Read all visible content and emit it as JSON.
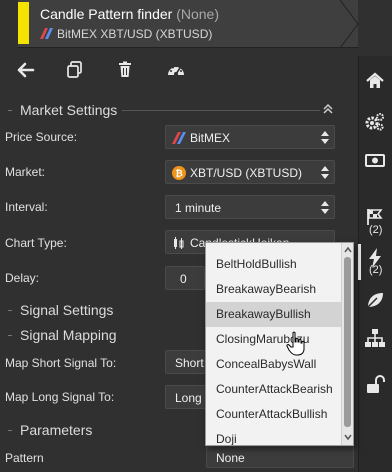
{
  "header": {
    "title": "Candle Pattern finder",
    "title_suffix": "(None)",
    "exchange_icon": "bitmex-logo-icon",
    "subtitle": "BitMEX XBT/USD (XBTUSD)",
    "accent_color": "#f4e200"
  },
  "toolbar": {
    "back_icon": "arrow-left-icon",
    "copy_icon": "copy-icon",
    "delete_icon": "trash-icon",
    "dashboard_icon": "gauge-icon"
  },
  "rail": {
    "items": [
      {
        "icon": "home-icon"
      },
      {
        "icon": "gears-icon"
      },
      {
        "icon": "money-icon"
      },
      {
        "icon": "bolt-icon",
        "count": "(2)"
      },
      {
        "icon": "flags-icon",
        "count": "(2)"
      },
      {
        "icon": "leaf-icon"
      },
      {
        "icon": "sitemap-icon"
      },
      {
        "icon": "unlock-icon"
      }
    ]
  },
  "market_settings": {
    "title": "Market Settings",
    "collapse_icon": "double-chevron-up-icon",
    "price_source": {
      "label": "Price Source:",
      "value": "BitMEX",
      "icon": "bitmex-logo-icon"
    },
    "market": {
      "label": "Market:",
      "value": "XBT/USD (XBTUSD)",
      "icon": "bitcoin-icon"
    },
    "interval": {
      "label": "Interval:",
      "value": "1 minute"
    },
    "chart_type": {
      "label": "Chart Type:",
      "value": "CandlestickHeikan",
      "icon": "candles-icon"
    },
    "delay": {
      "label": "Delay:",
      "value": "0"
    }
  },
  "signal_settings": {
    "title": "Signal Settings"
  },
  "signal_mapping": {
    "title": "Signal Mapping",
    "short": {
      "label": "Map Short Signal To:",
      "value": "Short"
    },
    "long": {
      "label": "Map Long Signal To:",
      "value": "Long"
    }
  },
  "parameters": {
    "title": "Parameters",
    "pattern": {
      "label": "Pattern",
      "value": "None"
    }
  },
  "pattern_dropdown": {
    "options": [
      "BeltHoldBullish",
      "BreakawayBearish",
      "BreakawayBullish",
      "ClosingMarubozu",
      "ConcealBabysWall",
      "CounterAttackBearish",
      "CounterAttackBullish",
      "Doji"
    ],
    "highlighted_index": 2
  }
}
